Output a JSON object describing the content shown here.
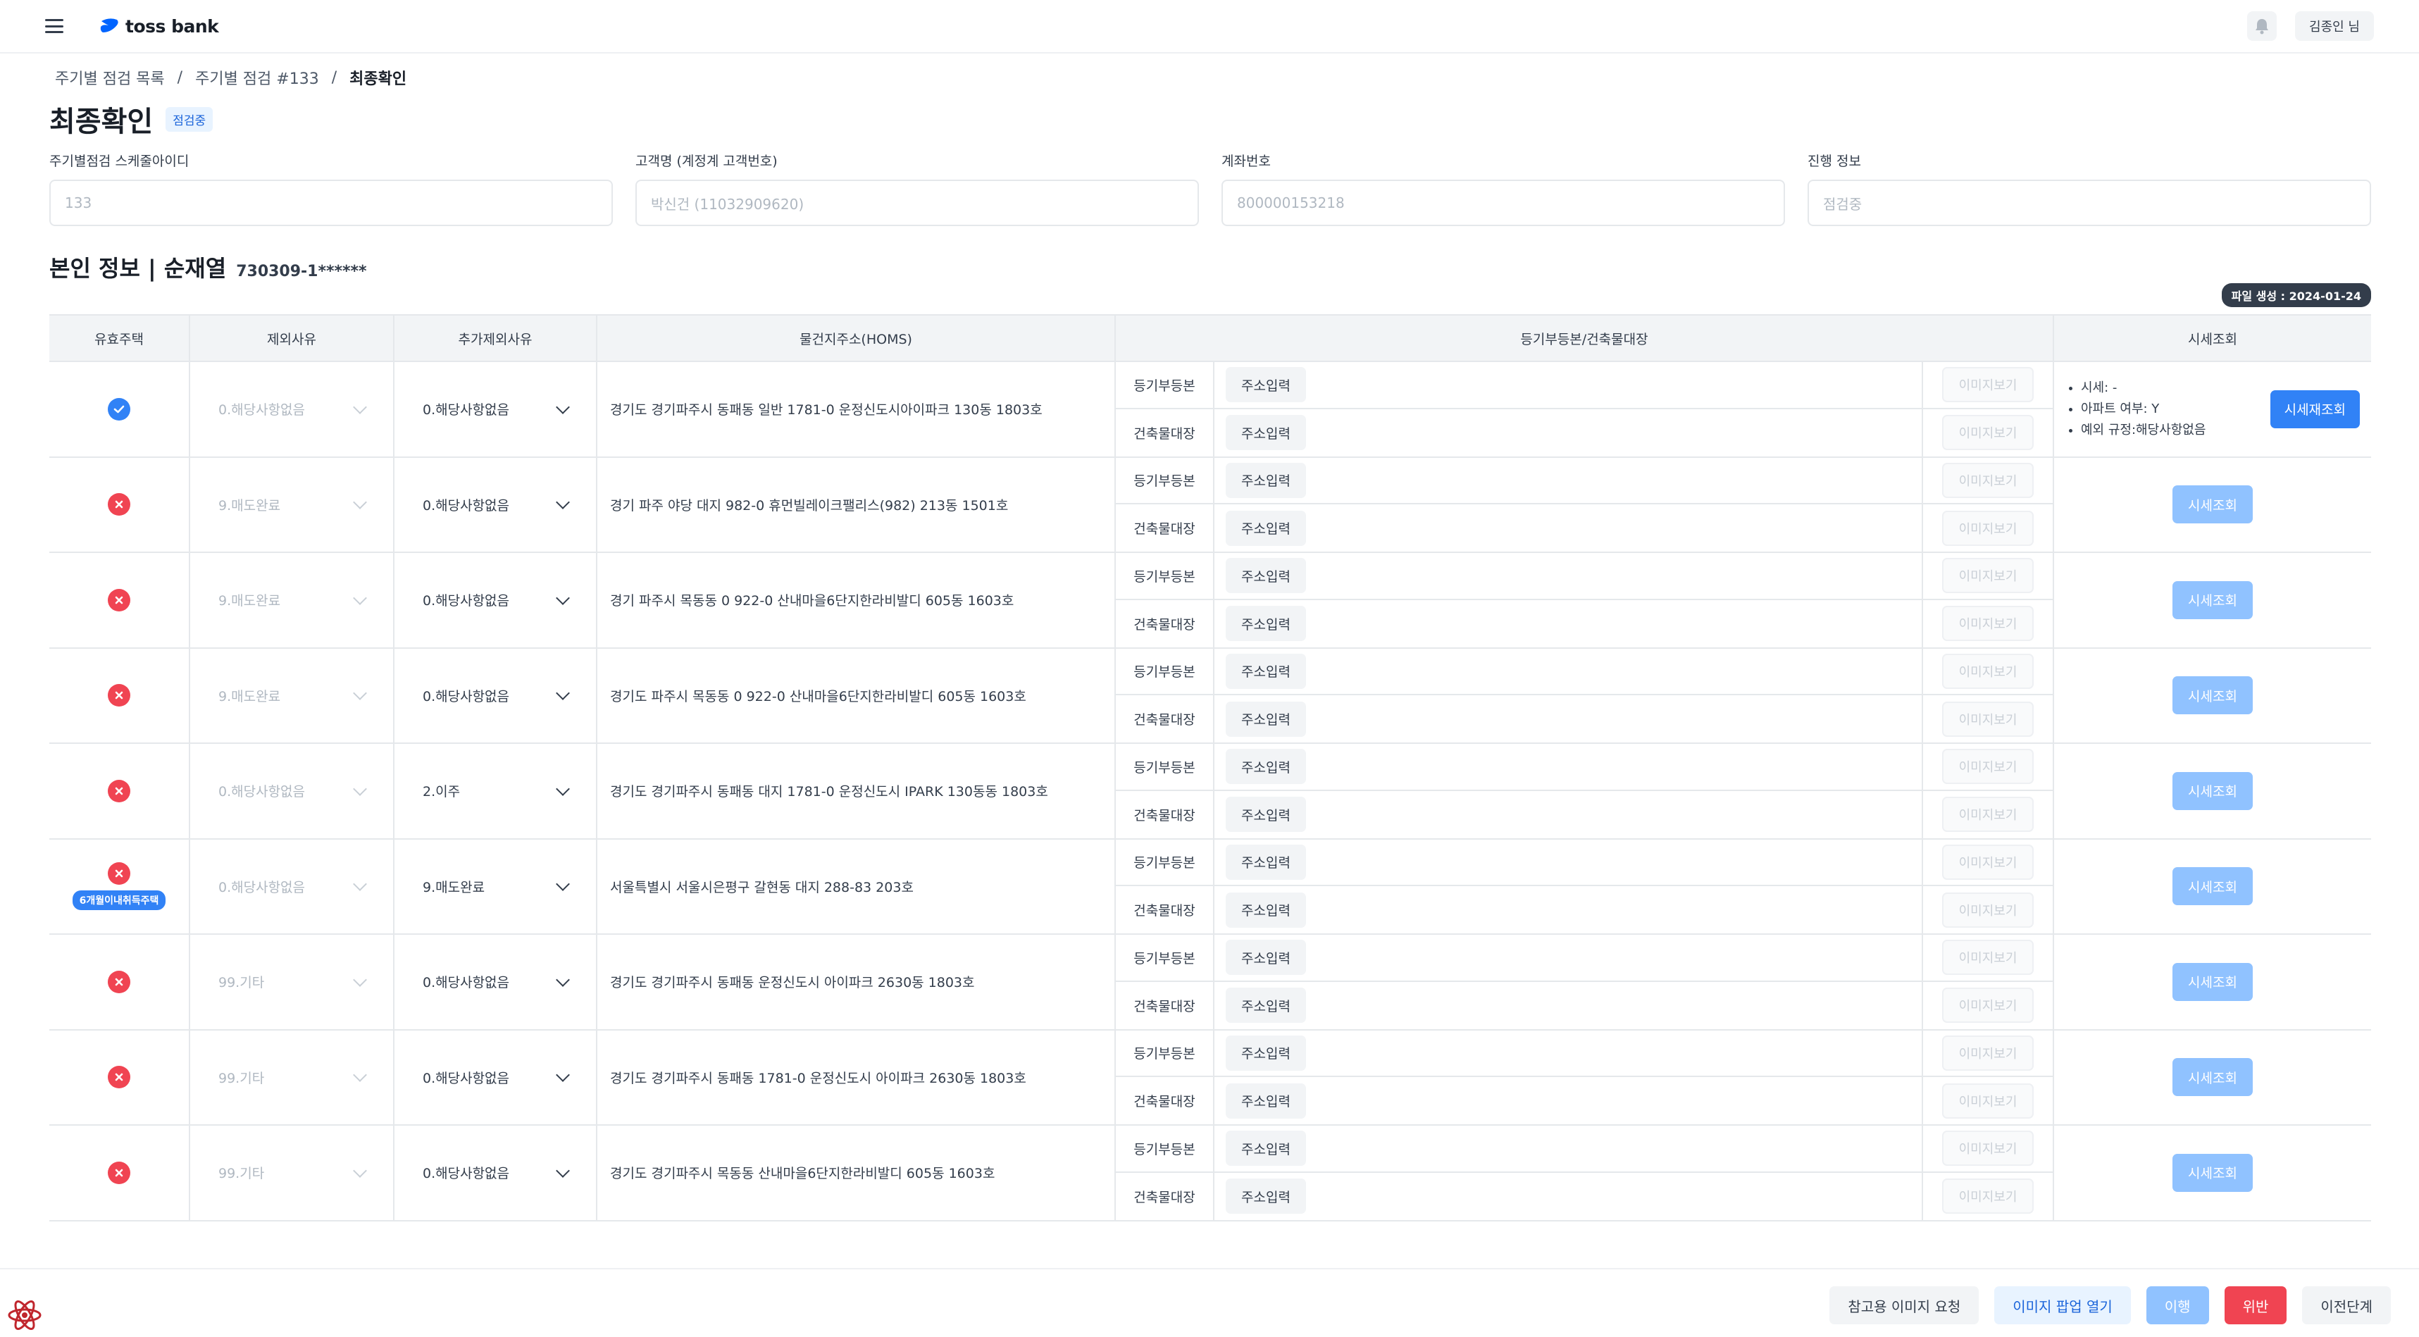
{
  "app": {
    "logo_text": "toss bank",
    "user_label": "김종인 님"
  },
  "breadcrumb": {
    "items": [
      "주기별 점검 목록",
      "주기별 점검 #133"
    ],
    "current": "최종확인",
    "separator": "/"
  },
  "page": {
    "title": "최종확인",
    "status_badge": "점검중"
  },
  "fields": [
    {
      "label": "주기별점검 스케줄아이디",
      "value": "133"
    },
    {
      "label": "고객명 (계정계 고객번호)",
      "value": "박신건 (11032909620)"
    },
    {
      "label": "계좌번호",
      "value": "800000153218"
    },
    {
      "label": "진행 정보",
      "value": "점검중"
    }
  ],
  "section": {
    "title": "본인 정보 | 순재열",
    "id_number": "730309-1******",
    "file_badge": "파일 생성 : 2024-01-24"
  },
  "table": {
    "headers": [
      "유효주택",
      "제외사유",
      "추가제외사유",
      "물건지주소(HOMS)",
      "등기부등본/건축물대장",
      "시세조회"
    ],
    "reg_labels": [
      "등기부등본",
      "건축물대장"
    ],
    "addr_button": "주소입력",
    "img_button": "이미지보기",
    "price_button": "시세조회",
    "rows": [
      {
        "valid": true,
        "tag": "",
        "exclude": "0.해당사항없음",
        "extra": "0.해당사항없음",
        "address": "경기도 경기파주시 동패동 일반 1781-0 운정신도시아이파크 130동 1803호"
      },
      {
        "valid": false,
        "tag": "",
        "exclude": "9.매도완료",
        "extra": "0.해당사항없음",
        "address": "경기 파주 야당 대지 982-0 휴먼빌레이크팰리스(982) 213동 1501호"
      },
      {
        "valid": false,
        "tag": "",
        "exclude": "9.매도완료",
        "extra": "0.해당사항없음",
        "address": "경기 파주시 목동동 0 922-0 산내마을6단지한라비발디 605동 1603호"
      },
      {
        "valid": false,
        "tag": "",
        "exclude": "9.매도완료",
        "extra": "0.해당사항없음",
        "address": "경기도 파주시 목동동 0 922-0 산내마을6단지한라비발디 605동 1603호"
      },
      {
        "valid": false,
        "tag": "",
        "exclude": "0.해당사항없음",
        "extra": "2.이주",
        "address": "경기도 경기파주시 동패동 대지 1781-0 운정신도시 IPARK 130동동 1803호"
      },
      {
        "valid": false,
        "tag": "6개월이내취득주택",
        "exclude": "0.해당사항없음",
        "extra": "9.매도완료",
        "address": "서울특별시 서울시은평구 갈현동 대지 288-83 203호"
      },
      {
        "valid": false,
        "tag": "",
        "exclude": "99.기타",
        "extra": "0.해당사항없음",
        "address": "경기도 경기파주시 동패동 운정신도시 아이파크 2630동 1803호"
      },
      {
        "valid": false,
        "tag": "",
        "exclude": "99.기타",
        "extra": "0.해당사항없음",
        "address": "경기도 경기파주시 동패동 1781-0 운정신도시 아이파크 2630동 1803호"
      },
      {
        "valid": false,
        "tag": "",
        "exclude": "99.기타",
        "extra": "0.해당사항없음",
        "address": "경기도 경기파주시 목동동 산내마을6단지한라비발디 605동 1603호"
      }
    ],
    "first_price": {
      "lines": [
        "시세: -",
        "아파트 여부: Y",
        "예외 규정:해당사항없음"
      ],
      "button": "시세재조회"
    }
  },
  "footer": {
    "buttons": [
      "참고용 이미지 요청",
      "이미지 팝업 열기",
      "이행",
      "위반",
      "이전단계"
    ]
  },
  "colors": {
    "primary": "#3182f6",
    "danger": "#f04452",
    "disabled_primary": "#90c2ff"
  }
}
